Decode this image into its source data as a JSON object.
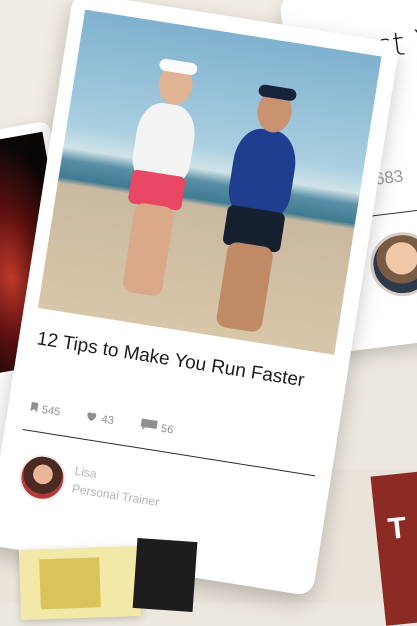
{
  "right_card": {
    "title": "Boost Your",
    "saves": "683"
  },
  "main_card": {
    "title": "12 Tips to Make You Run Faster",
    "saves": "545",
    "likes": "43",
    "comments": "56",
    "author_name": "Lisa",
    "author_role": "Personal Trainer"
  },
  "red_card": {
    "letter": "T"
  },
  "colors": {
    "accent_red": "#8c2b23",
    "text_gray": "#9a9a9a"
  },
  "icons": [
    "bookmark-icon",
    "heart-icon",
    "comment-icon"
  ]
}
